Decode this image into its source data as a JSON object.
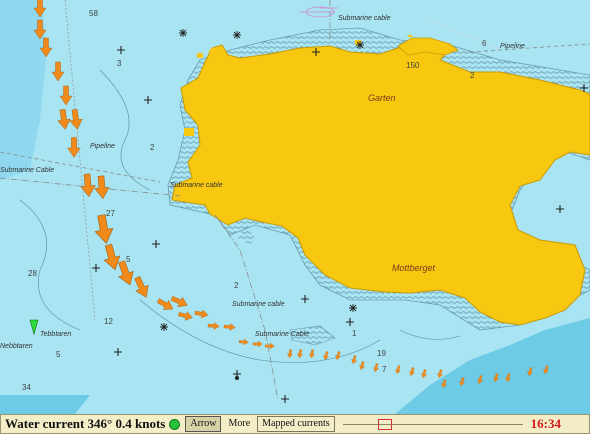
{
  "map": {
    "places": {
      "garten": "Garten",
      "mottberget": "Mottberget"
    },
    "features": {
      "pipeline_west": "Pipeline",
      "pipeline_east": "Pipeline",
      "submarine_cable_west": "Submarine Cable",
      "submarine_cable_top": "Submarine cable",
      "submarine_cable_mid": "Submarine cable",
      "submarine_cable_south": "Submarine cable",
      "submarine_cable_low": "Submarine Cable",
      "nebbtaren": "Nebbtaren",
      "tebbtaren": "Tebbtaren"
    },
    "depths": {
      "d58": "58",
      "d3": "3",
      "d2a": "2",
      "d2b": "2",
      "d27": "27",
      "d5a": "5",
      "d28": "28",
      "d12": "12",
      "d5b": "5",
      "d34": "34",
      "d2c": "2",
      "d1": "1",
      "d19": "19",
      "d7": "7",
      "d6": "6",
      "d150": "150"
    },
    "colors": {
      "water": "#a8e4f2",
      "deep_water": "#6ecbe6",
      "land": "#f8c70f",
      "shallow": "#7fb4c8",
      "current_arrow": "#f08a1a"
    },
    "current_direction_deg": 346
  },
  "toolbar": {
    "label": "Water current 346° 0.4 knots",
    "status_color": "#27c13a",
    "arrow_button": "Arrow",
    "more_button": "More",
    "mapped_button": "Mapped currents",
    "time": "16:34",
    "timeline_position": 0.23
  }
}
